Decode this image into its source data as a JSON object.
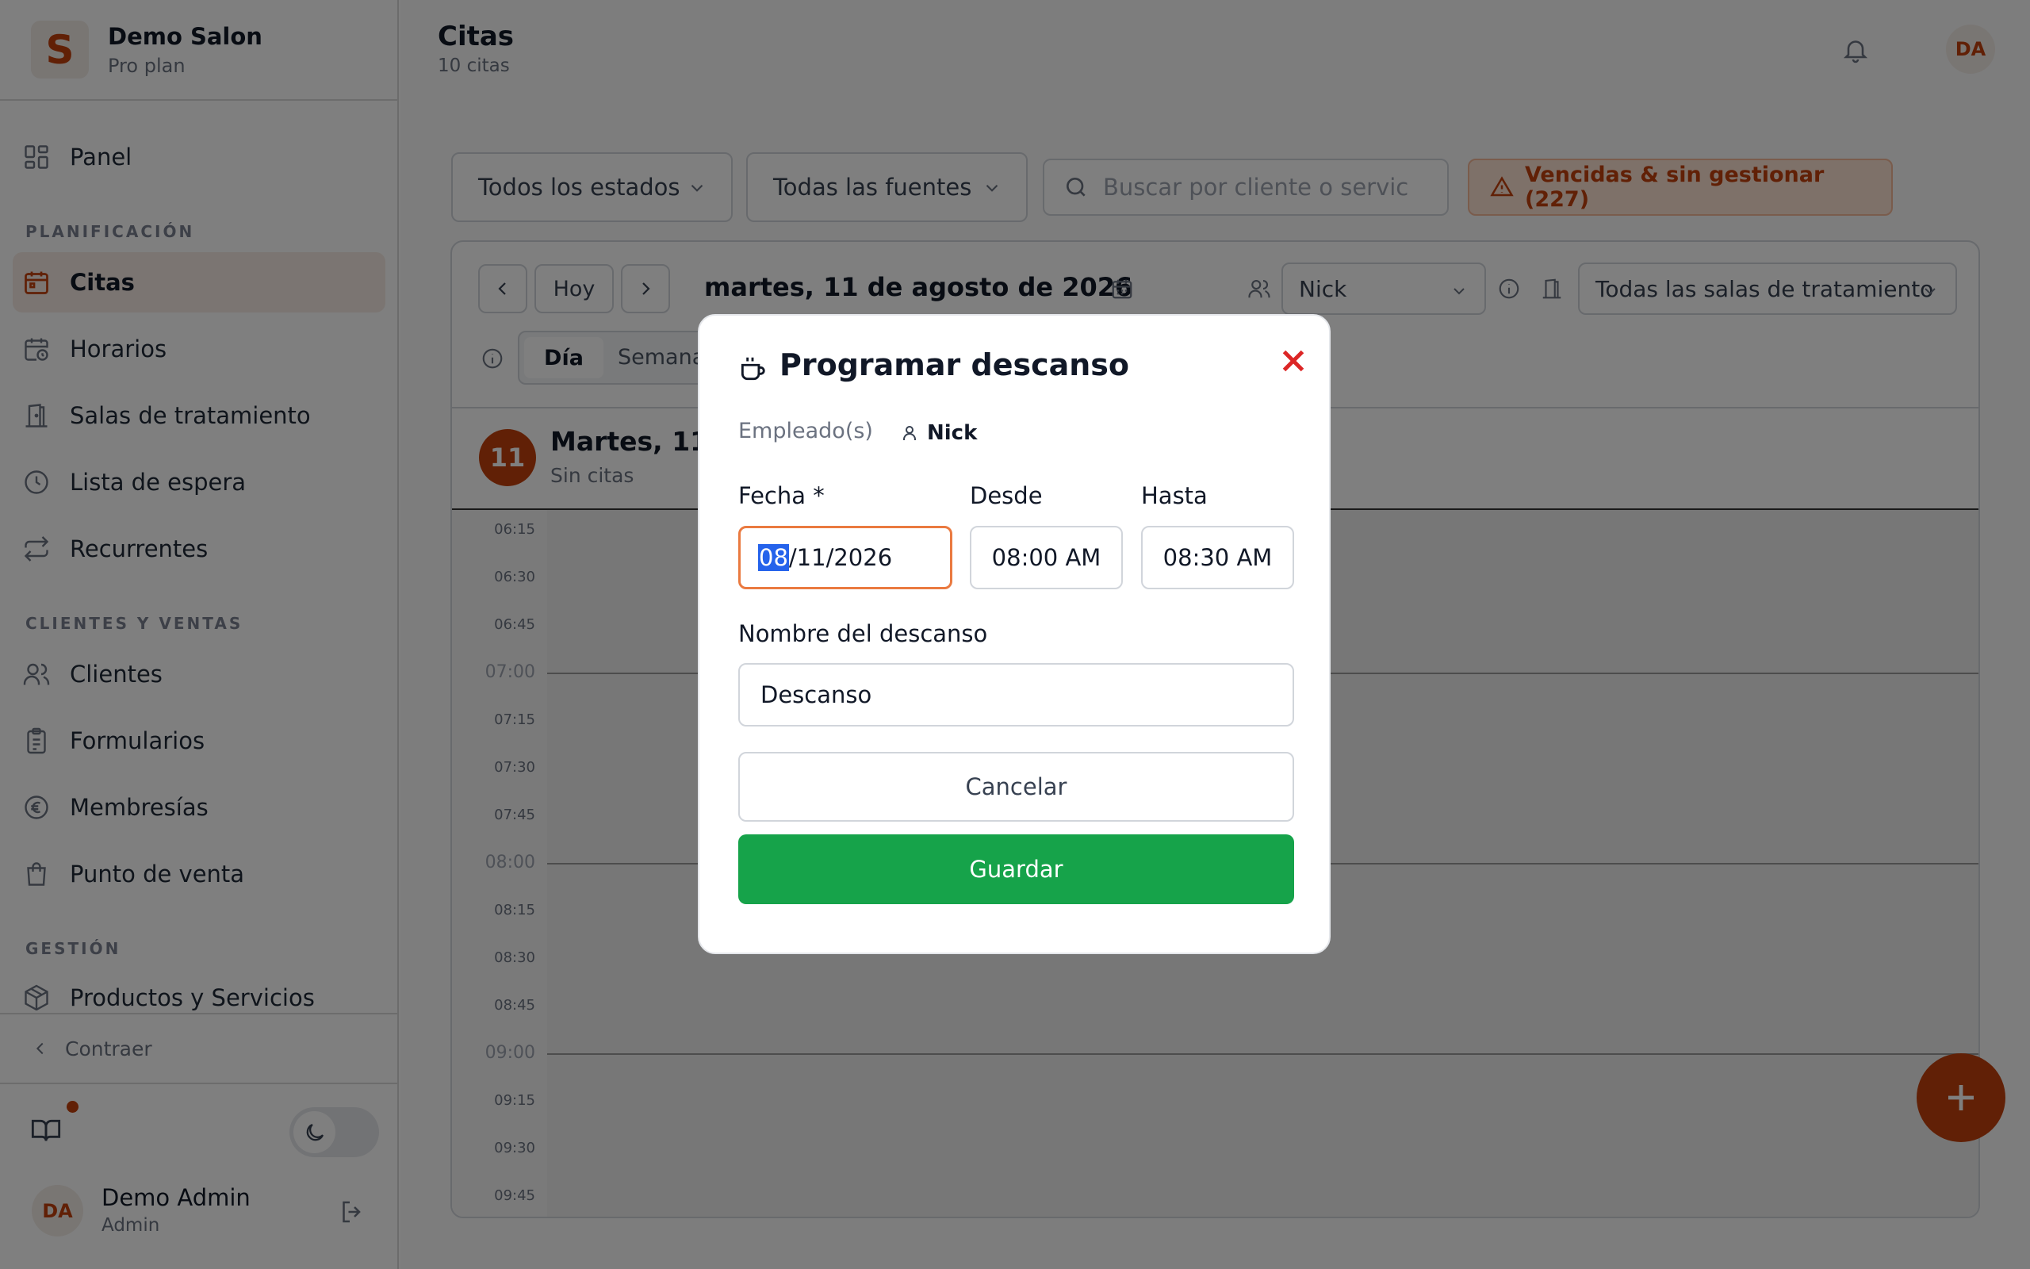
{
  "sidebar": {
    "brand_initial": "S",
    "brand_name": "Demo Salon",
    "brand_plan": "Pro plan",
    "panel": "Panel",
    "section_planning": "PLANIFICACIÓN",
    "planning_items": [
      "Citas",
      "Horarios",
      "Salas de tratamiento",
      "Lista de espera",
      "Recurrentes"
    ],
    "section_clients": "CLIENTES Y VENTAS",
    "client_items": [
      "Clientes",
      "Formularios",
      "Membresías",
      "Punto de venta"
    ],
    "section_management": "GESTIÓN",
    "management_items": [
      "Productos y Servicios"
    ],
    "collapse": "Contraer",
    "user_initials": "DA",
    "user_name": "Demo Admin",
    "user_role": "Admin"
  },
  "header": {
    "title": "Citas",
    "subtitle": "10 citas",
    "avatar_initials": "DA"
  },
  "filters": {
    "status": "Todos los estados",
    "source": "Todas las fuentes",
    "search_placeholder": "Buscar por cliente o servic",
    "overdue": "Vencidas & sin gestionar (227)"
  },
  "calendar": {
    "today_button": "Hoy",
    "date_label": "martes, 11 de agosto de 2026",
    "employee_select": "Nick",
    "room_select": "Todas las salas de tratamiento",
    "view_day": "Día",
    "view_week": "Semana",
    "day_number": "11",
    "day_label": "Martes, 11",
    "day_sub": "Sin citas",
    "time_labels": [
      "06:15",
      "06:30",
      "06:45",
      "07:00",
      "07:15",
      "07:30",
      "07:45",
      "08:00",
      "08:15",
      "08:30",
      "08:45",
      "09:00",
      "09:15",
      "09:30",
      "09:45"
    ]
  },
  "modal": {
    "title": "Programar descanso",
    "employees_label": "Empleado(s)",
    "employee_name": "Nick",
    "date_label": "Fecha *",
    "from_label": "Desde",
    "to_label": "Hasta",
    "date_month": "08",
    "date_rest": "/11/2026",
    "from_value": "08:00 AM",
    "to_value": "08:30 AM",
    "name_label": "Nombre del descanso",
    "name_value": "Descanso",
    "cancel": "Cancelar",
    "save": "Guardar"
  },
  "colors": {
    "accent": "#c2410c",
    "save_green": "#16a34a",
    "close_red": "#dc2626",
    "focus_border": "#ea7a40"
  }
}
